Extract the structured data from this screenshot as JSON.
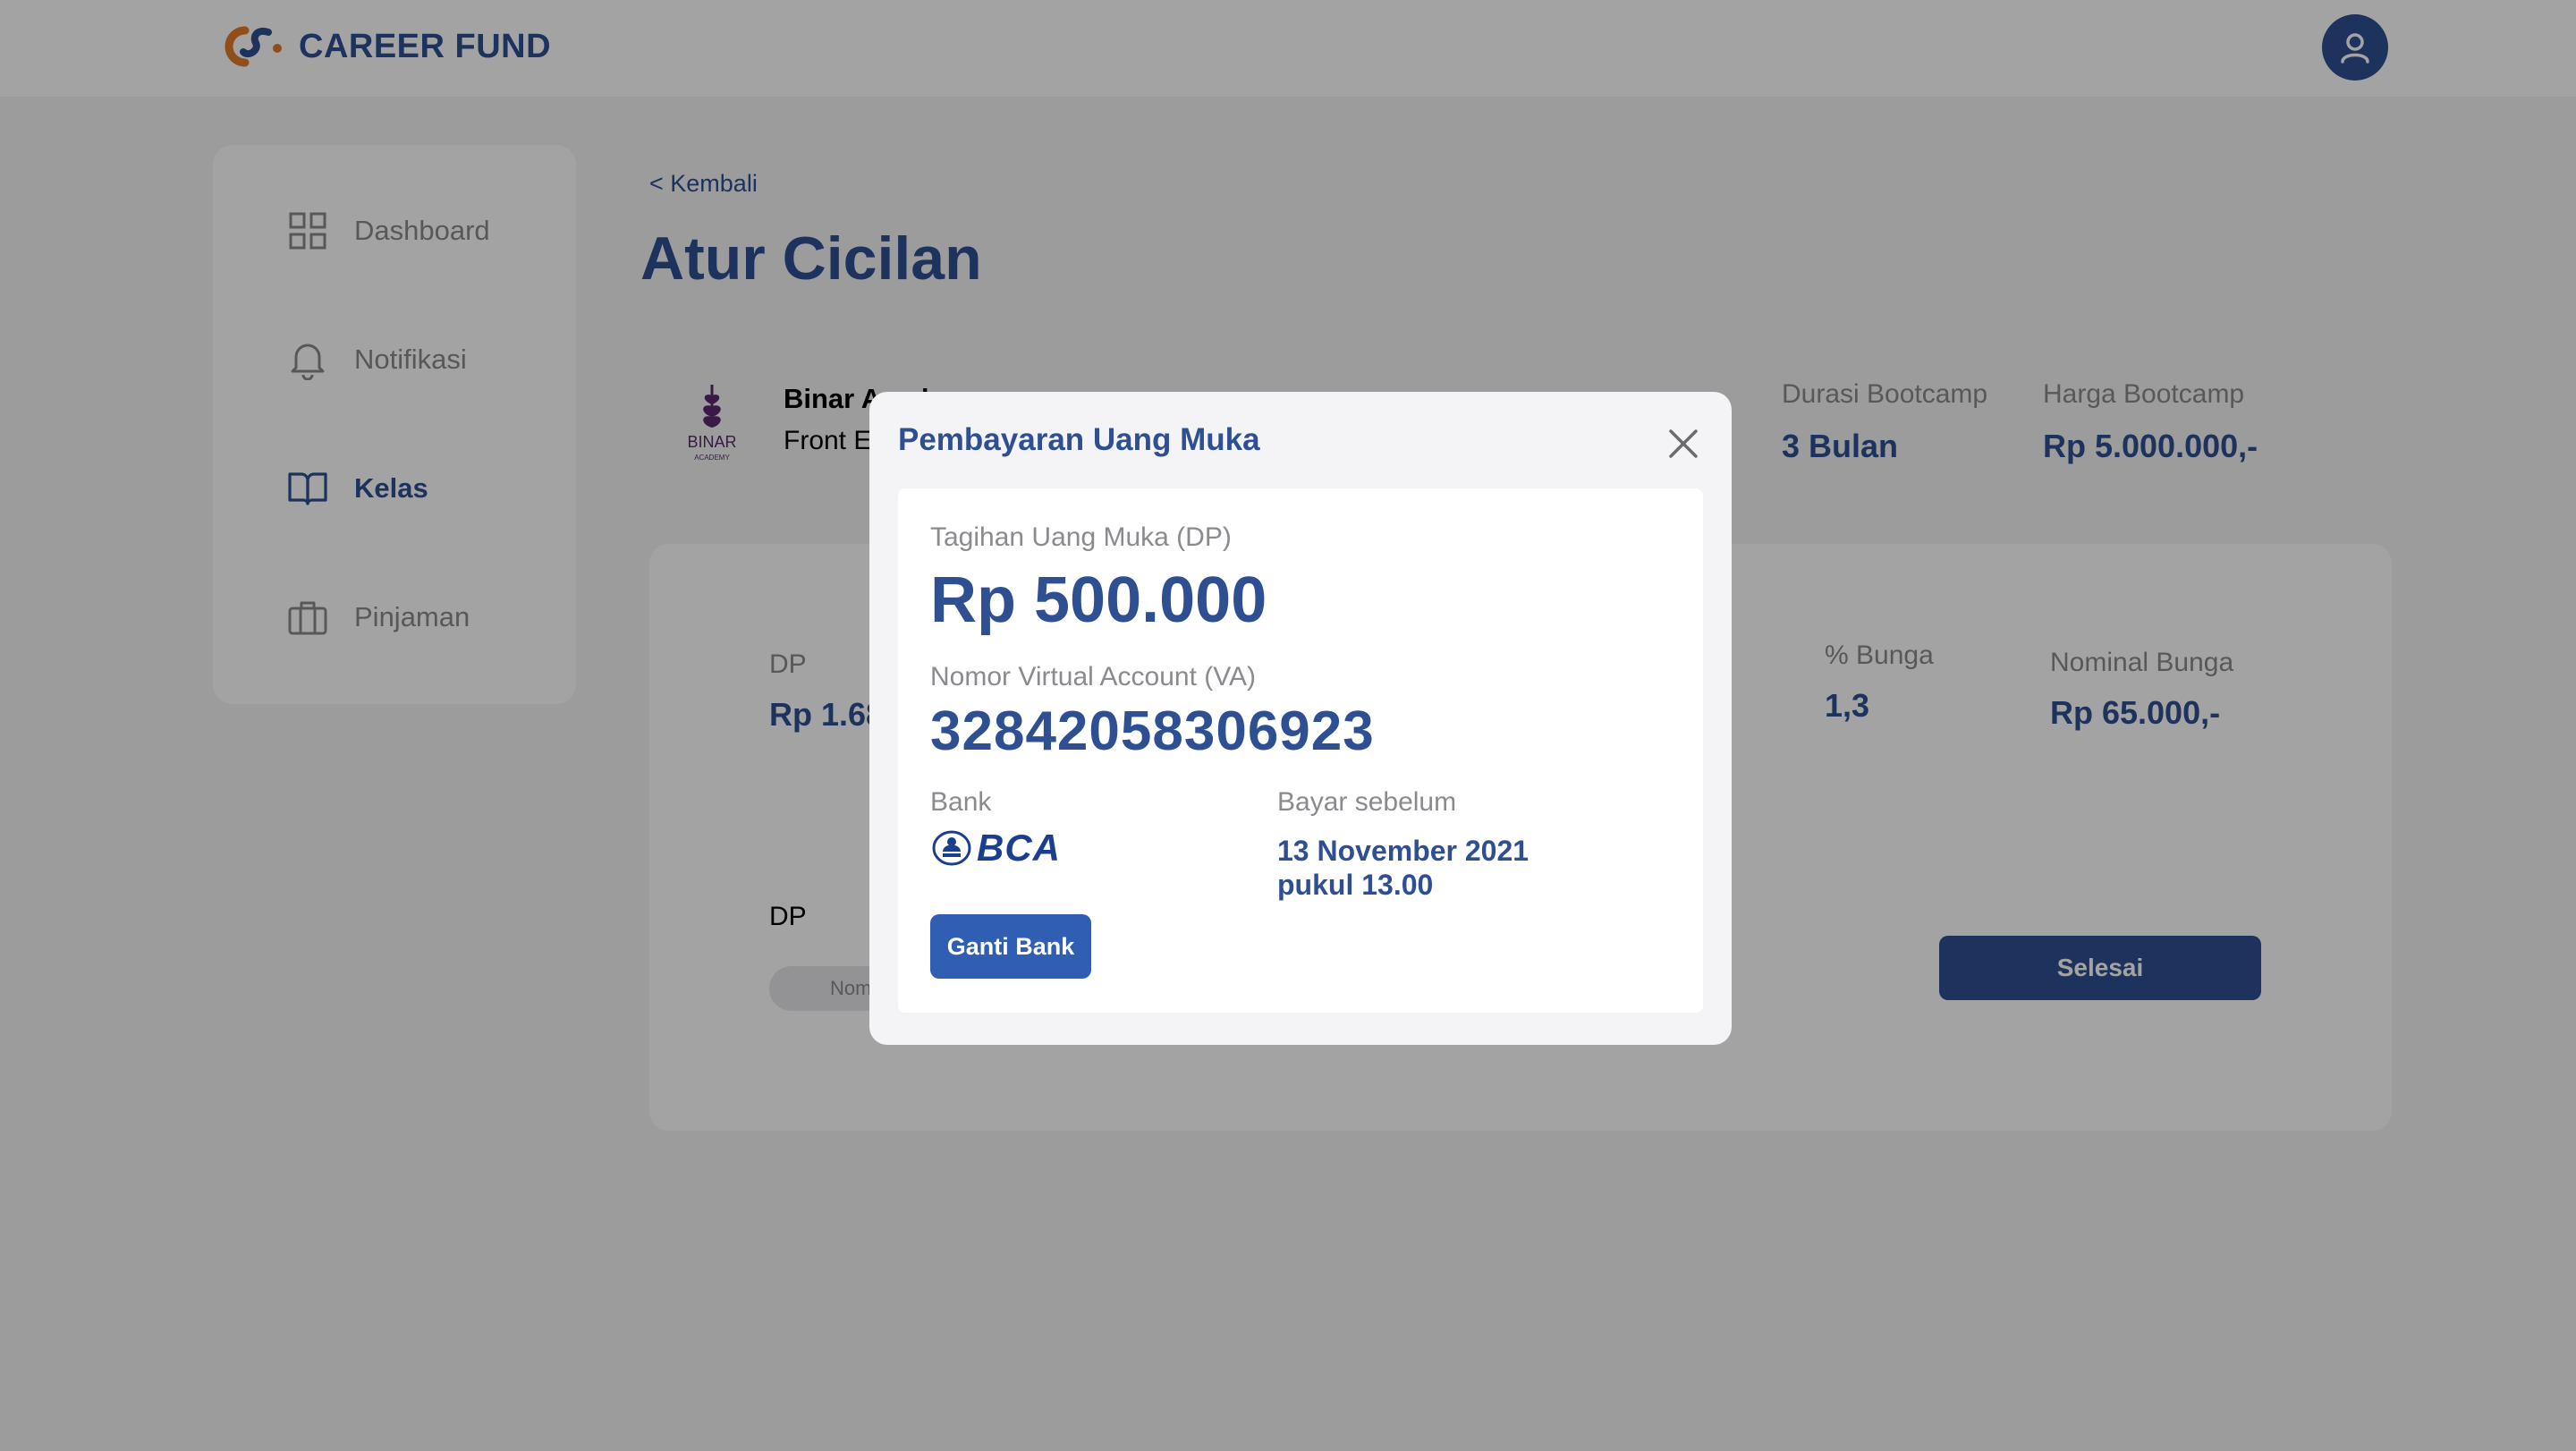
{
  "brand": {
    "name": "CAREER FUND"
  },
  "header": {
    "avatar_icon": "user-icon"
  },
  "sidebar": {
    "items": [
      {
        "label": "Dashboard",
        "icon": "grid-icon"
      },
      {
        "label": "Notifikasi",
        "icon": "bell-icon"
      },
      {
        "label": "Kelas",
        "icon": "book-icon",
        "active": true
      },
      {
        "label": "Pinjaman",
        "icon": "briefcase-icon"
      }
    ]
  },
  "main": {
    "back_link": "< Kembali",
    "title": "Atur Cicilan",
    "course": {
      "logo_text": "BINAR",
      "logo_subtext": "ACADEMY",
      "name": "Binar Academy",
      "program": "Front End",
      "duration_label": "Durasi Bootcamp",
      "duration_value": "3 Bulan",
      "price_label": "Harga Bootcamp",
      "price_value": "Rp  5.000.000,-"
    },
    "card": {
      "dp_label": "DP",
      "dp_value": "Rp 1.68",
      "interest_pct_label": "% Bunga",
      "interest_pct_value": "1,3",
      "interest_nominal_label": "Nominal Bunga",
      "interest_nominal_value": "Rp  65.000,-",
      "dp_input_label": "DP",
      "dp_input_placeholder": "Nom",
      "done_button": "Selesai"
    }
  },
  "modal": {
    "title": "Pembayaran Uang Muka",
    "bill_label": "Tagihan Uang Muka (DP)",
    "bill_amount": "Rp 500.000",
    "va_label": "Nomor Virtual Account (VA)",
    "va_number": "32842058306923",
    "bank_label": "Bank",
    "bank_name": "BCA",
    "due_label": "Bayar sebelum",
    "due_date": "13 November 2021",
    "due_time": "pukul 13.00",
    "change_bank_button": "Ganti Bank"
  },
  "colors": {
    "primary": "#2f4f93",
    "button": "#2f5eb3",
    "muted_text": "#8a8a8f",
    "page_bg": "#f4f4f6",
    "overlay": "rgba(0,0,0,0.36)"
  }
}
